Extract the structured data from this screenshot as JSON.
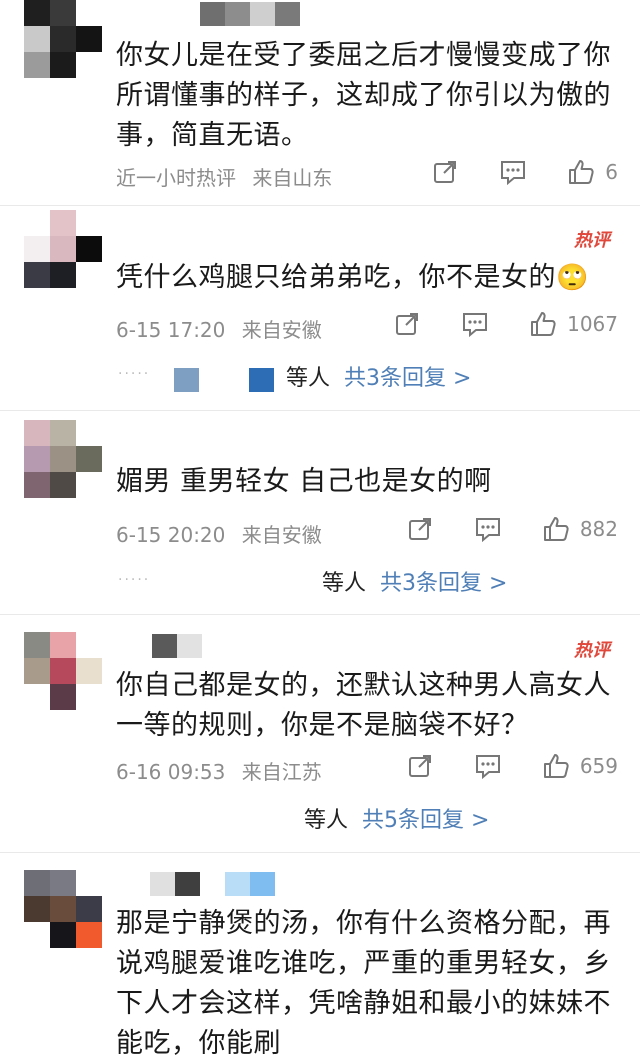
{
  "comments": [
    {
      "text": "你女儿是在受了委屈之后才慢慢变成了你所谓懂事的样子，这却成了你引以为傲的事，简直无语。",
      "time": "近一小时热评",
      "location": "来自山东",
      "likes": "6",
      "hot_label": ""
    },
    {
      "text": "凭什么鸡腿只给弟弟吃，你不是女的",
      "emoji": "🙄",
      "time": "6-15 17:20",
      "location": "来自安徽",
      "likes": "1067",
      "hot_label": "热评",
      "replies_prefix": "等人",
      "replies_link": "共3条回复 >"
    },
    {
      "text": "媚男 重男轻女 自己也是女的啊",
      "time": "6-15 20:20",
      "location": "来自安徽",
      "likes": "882",
      "hot_label": "",
      "replies_prefix": "等人",
      "replies_link": "共3条回复 >"
    },
    {
      "text": "你自己都是女的，还默认这种男人高女人一等的规则，你是不是脑袋不好？",
      "time": "6-16 09:53",
      "location": "来自江苏",
      "likes": "659",
      "hot_label": "热评",
      "replies_prefix": "等人",
      "replies_link": "共5条回复 >"
    },
    {
      "text": "那是宁静煲的汤，你有什么资格分配，再说鸡腿爱谁吃谁吃，严重的重男轻女，乡下人才会这样，凭啥静姐和最小的妹妹不能吃，你能刷"
    }
  ],
  "icons": {
    "share": "share-icon",
    "comment": "comment-icon",
    "like": "thumbs-up-icon"
  },
  "colors": {
    "link": "#4f7fb6",
    "meta": "#8c8c8c",
    "hot": "#e0483c"
  }
}
